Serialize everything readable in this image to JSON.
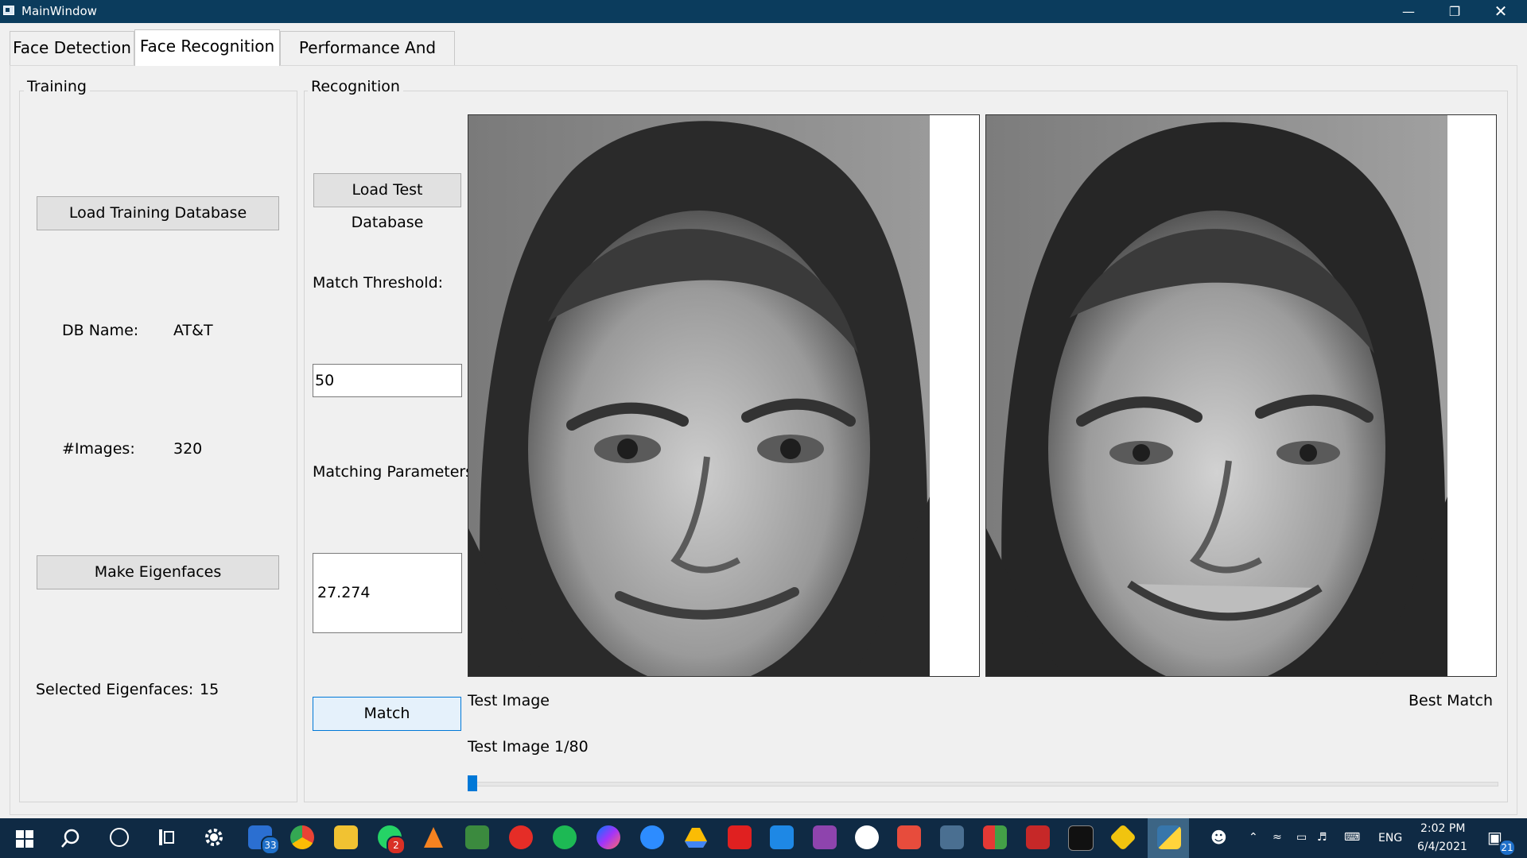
{
  "window": {
    "title": "MainWindow"
  },
  "tabs": [
    {
      "label": "Face Detection"
    },
    {
      "label": "Face Recognition"
    },
    {
      "label": "Performance And ROC"
    }
  ],
  "training": {
    "group_title": "Training",
    "load_button": "Load Training Database",
    "db_name_label": "DB Name:",
    "db_name_value": "AT&T",
    "images_label": "#Images:",
    "images_value": "320",
    "eigen_button": "Make Eigenfaces",
    "selected_label": "Selected Eigenfaces:",
    "selected_value": "15"
  },
  "recognition": {
    "group_title": "Recognition",
    "load_test_button": "Load Test Database",
    "threshold_label": "Match Threshold:",
    "threshold_value": "50",
    "params_label": "Matching Parameters",
    "params_value": "27.274",
    "match_button": "Match",
    "test_image_caption": "Test Image",
    "best_match_caption": "Best Match",
    "test_image_counter": "Test Image 1/80",
    "slider_position_fraction": 0.0
  },
  "taskbar": {
    "mail_badge": "33",
    "whatsapp_badge": "2",
    "language": "ENG",
    "time": "2:02 PM",
    "date": "6/4/2021",
    "notification_count": "21"
  },
  "colors": {
    "titlebar": "#0b3c5d",
    "taskbar": "#0f2a44",
    "accent": "#0078d7"
  }
}
